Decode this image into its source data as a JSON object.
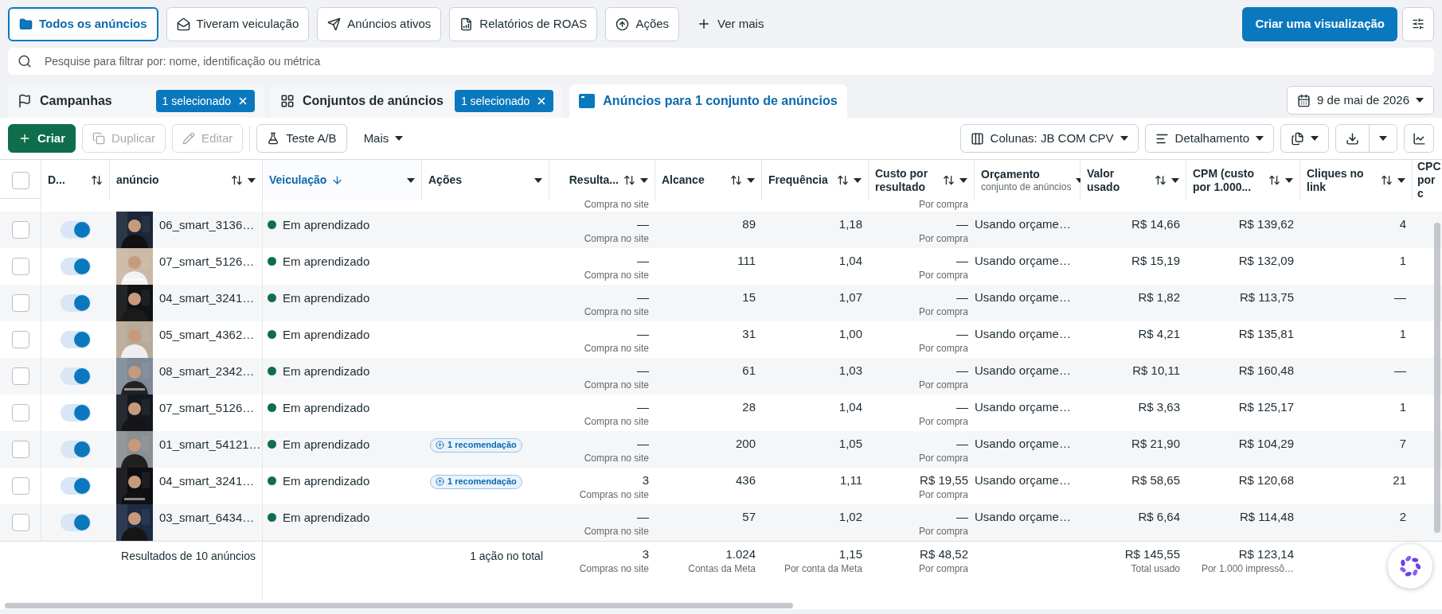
{
  "view_tabs": [
    {
      "label": "Todos os anúncios",
      "selected": true
    },
    {
      "label": "Tiveram veiculação",
      "selected": false
    },
    {
      "label": "Anúncios ativos",
      "selected": false
    },
    {
      "label": "Relatórios de ROAS",
      "selected": false
    },
    {
      "label": "Ações",
      "selected": false
    }
  ],
  "more_views": "Ver mais",
  "create_view": "Criar uma visualização",
  "search": {
    "placeholder": "Pesquise para filtrar por: nome, identificação ou métrica"
  },
  "level_tabs": [
    {
      "label": "Campanhas",
      "badge": "1 selecionado",
      "selected": false
    },
    {
      "label": "Conjuntos de anúncios",
      "badge": "1 selecionado",
      "selected": false
    },
    {
      "label": "Anúncios para 1 conjunto de anúncios",
      "selected": true
    }
  ],
  "date": "9 de mai de 2026",
  "toolbar": {
    "left": [
      {
        "label": "Criar",
        "kind": "primary",
        "disabled": false
      },
      {
        "label": "Duplicar",
        "kind": "plain",
        "disabled": true
      },
      {
        "label": "Editar",
        "kind": "plain",
        "disabled": true
      },
      {
        "label": "Teste A/B",
        "kind": "plain",
        "disabled": false
      },
      {
        "label": "Mais",
        "kind": "menu",
        "disabled": false
      }
    ],
    "columns_button": "Colunas: JB COM CPV",
    "breakdown_button": "Detalhamento"
  },
  "select_all": {
    "checked": false
  },
  "columns": [
    {
      "label": "D...",
      "sortable": true,
      "menu": false,
      "sorted": false
    },
    {
      "label": "anúncio",
      "sortable": true,
      "menu": true,
      "sorted": false
    },
    {
      "label": "Veiculação",
      "sortable": false,
      "menu": true,
      "sorted": true
    },
    {
      "label": "Ações",
      "sortable": false,
      "menu": true,
      "sorted": false
    },
    {
      "label": "Resulta...",
      "sortable": true,
      "menu": true,
      "sorted": false
    },
    {
      "label": "Alcance",
      "sortable": true,
      "menu": true,
      "sorted": false
    },
    {
      "label": "Frequência",
      "sortable": true,
      "menu": true,
      "sorted": false
    },
    {
      "label": "Custo por resultado",
      "sortable": true,
      "menu": true,
      "sorted": false
    },
    {
      "label": "Orçamento",
      "sub": "conjunto de anúncios",
      "sortable": false,
      "menu": true,
      "sorted": false
    },
    {
      "label": "Valor usado",
      "sortable": true,
      "menu": true,
      "sorted": false
    },
    {
      "label": "CPM (custo por 1.000...",
      "sortable": true,
      "menu": true,
      "sorted": false
    },
    {
      "label": "Cliques no link",
      "sortable": true,
      "menu": true,
      "sorted": false
    },
    {
      "label": "CPC por c",
      "sorted": false
    }
  ],
  "partial_row": {
    "results_note": "Compra no site",
    "cost_note": "Por compra"
  },
  "rows": [
    {
      "selected": false,
      "on": true,
      "name": "06_smart_3136…",
      "delivery": "Em aprendizado",
      "results": "—",
      "results_note": "Compra no site",
      "reach": "89",
      "frequency": "1,18",
      "cost": "—",
      "cost_note": "Por compra",
      "budget": "Usando orçame…",
      "spent": "R$ 14,66",
      "cpm": "R$ 139,62",
      "clicks": "4"
    },
    {
      "selected": false,
      "on": true,
      "name": "07_smart_5126…",
      "delivery": "Em aprendizado",
      "results": "—",
      "results_note": "Compra no site",
      "reach": "111",
      "frequency": "1,04",
      "cost": "—",
      "cost_note": "Por compra",
      "budget": "Usando orçame…",
      "spent": "R$ 15,19",
      "cpm": "R$ 132,09",
      "clicks": "1"
    },
    {
      "selected": false,
      "on": true,
      "name": "04_smart_3241…",
      "delivery": "Em aprendizado",
      "results": "—",
      "results_note": "Compra no site",
      "reach": "15",
      "frequency": "1,07",
      "cost": "—",
      "cost_note": "Por compra",
      "budget": "Usando orçame…",
      "spent": "R$ 1,82",
      "cpm": "R$ 113,75",
      "clicks": "—"
    },
    {
      "selected": false,
      "on": true,
      "name": "05_smart_4362…",
      "delivery": "Em aprendizado",
      "results": "—",
      "results_note": "Compra no site",
      "reach": "31",
      "frequency": "1,00",
      "cost": "—",
      "cost_note": "Por compra",
      "budget": "Usando orçame…",
      "spent": "R$ 4,21",
      "cpm": "R$ 135,81",
      "clicks": "1"
    },
    {
      "selected": false,
      "on": true,
      "name": "08_smart_2342…",
      "delivery": "Em aprendizado",
      "results": "—",
      "results_note": "Compra no site",
      "reach": "61",
      "frequency": "1,03",
      "cost": "—",
      "cost_note": "Por compra",
      "budget": "Usando orçame…",
      "spent": "R$ 10,11",
      "cpm": "R$ 160,48",
      "clicks": "—"
    },
    {
      "selected": false,
      "on": true,
      "name": "07_smart_5126…",
      "delivery": "Em aprendizado",
      "results": "—",
      "results_note": "Compra no site",
      "reach": "28",
      "frequency": "1,04",
      "cost": "—",
      "cost_note": "Por compra",
      "budget": "Usando orçame…",
      "spent": "R$ 3,63",
      "cpm": "R$ 125,17",
      "clicks": "1"
    },
    {
      "selected": false,
      "on": true,
      "name": "01_smart_54121…",
      "delivery": "Em aprendizado",
      "action": "1 recomendação",
      "results": "—",
      "results_note": "Compra no site",
      "reach": "200",
      "frequency": "1,05",
      "cost": "—",
      "cost_note": "Por compra",
      "budget": "Usando orçame…",
      "spent": "R$ 21,90",
      "cpm": "R$ 104,29",
      "clicks": "7"
    },
    {
      "selected": false,
      "on": true,
      "name": "04_smart_3241…",
      "delivery": "Em aprendizado",
      "action": "1 recomendação",
      "results": "3",
      "results_note": "Compras no site",
      "reach": "436",
      "frequency": "1,11",
      "cost": "R$ 19,55",
      "cost_note": "Por compra",
      "budget": "Usando orçame…",
      "spent": "R$ 58,65",
      "cpm": "R$ 120,68",
      "clicks": "21"
    },
    {
      "selected": false,
      "on": true,
      "name": "03_smart_6434…",
      "delivery": "Em aprendizado",
      "results": "—",
      "results_note": "Compra no site",
      "reach": "57",
      "frequency": "1,02",
      "cost": "—",
      "cost_note": "Por compra",
      "budget": "Usando orçame…",
      "spent": "R$ 6,64",
      "cpm": "R$ 114,48",
      "clicks": "2"
    }
  ],
  "totals": {
    "label": "Resultados de 10 anúncios",
    "actions": "1 ação no total",
    "results": "3",
    "results_note": "Compras no site",
    "reach": "1.024",
    "reach_note": "Contas da Meta",
    "frequency": "1,15",
    "frequency_note": "Por conta da Meta",
    "cost": "R$ 48,52",
    "cost_note": "Por compra",
    "spent": "R$ 145,55",
    "spent_note": "Total usado",
    "cpm": "R$ 123,14",
    "cpm_note": "Por 1.000 impressõ…"
  }
}
